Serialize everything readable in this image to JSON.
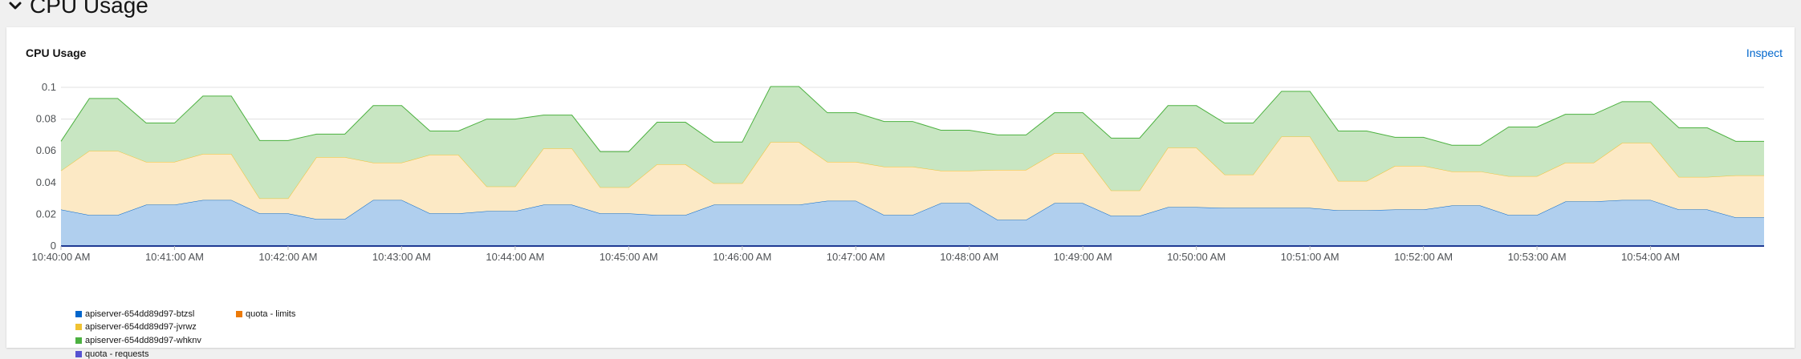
{
  "section": {
    "title": "CPU Usage",
    "chevron_icon": "chevron-down-icon"
  },
  "card": {
    "title": "CPU Usage",
    "inspect_label": "Inspect"
  },
  "colors": {
    "background": "#f0f0f0",
    "card": "#ffffff",
    "link": "#0066cc",
    "grid": "#e0e0e0"
  },
  "chart_data": {
    "type": "area",
    "stacked": true,
    "title": "CPU Usage",
    "xlabel": "",
    "ylabel": "",
    "ylim": [
      0,
      0.1
    ],
    "yticks": [
      0,
      0.02,
      0.04,
      0.06,
      0.08,
      0.1
    ],
    "ytick_labels": [
      "0",
      "0.02",
      "0.04",
      "0.06",
      "0.08",
      "0.1"
    ],
    "xlim": [
      "10:40:00 AM",
      "10:55:00 AM"
    ],
    "x_labels": [
      "10:40:00 AM",
      "10:41:00 AM",
      "10:42:00 AM",
      "10:43:00 AM",
      "10:44:00 AM",
      "10:45:00 AM",
      "10:46:00 AM",
      "10:47:00 AM",
      "10:48:00 AM",
      "10:49:00 AM",
      "10:50:00 AM",
      "10:51:00 AM",
      "10:52:00 AM",
      "10:53:00 AM",
      "10:54:00 AM"
    ],
    "grid": true,
    "legend_position": "bottom-left",
    "x": [
      "10:40:00 AM",
      "10:40:15 AM",
      "10:40:30 AM",
      "10:40:45 AM",
      "10:41:00 AM",
      "10:41:15 AM",
      "10:41:30 AM",
      "10:41:45 AM",
      "10:42:00 AM",
      "10:42:15 AM",
      "10:42:30 AM",
      "10:42:45 AM",
      "10:43:00 AM",
      "10:43:15 AM",
      "10:43:30 AM",
      "10:43:45 AM",
      "10:44:00 AM",
      "10:44:15 AM",
      "10:44:30 AM",
      "10:44:45 AM",
      "10:45:00 AM",
      "10:45:15 AM",
      "10:45:30 AM",
      "10:45:45 AM",
      "10:46:00 AM",
      "10:46:15 AM",
      "10:46:30 AM",
      "10:46:45 AM",
      "10:47:00 AM",
      "10:47:15 AM",
      "10:47:30 AM",
      "10:47:45 AM",
      "10:48:00 AM",
      "10:48:15 AM",
      "10:48:30 AM",
      "10:48:45 AM",
      "10:49:00 AM",
      "10:49:15 AM",
      "10:49:30 AM",
      "10:49:45 AM",
      "10:50:00 AM",
      "10:50:15 AM",
      "10:50:30 AM",
      "10:50:45 AM",
      "10:51:00 AM",
      "10:51:15 AM",
      "10:51:30 AM",
      "10:51:45 AM",
      "10:52:00 AM",
      "10:52:15 AM",
      "10:52:30 AM",
      "10:52:45 AM",
      "10:53:00 AM",
      "10:53:15 AM",
      "10:53:30 AM",
      "10:53:45 AM",
      "10:54:00 AM",
      "10:54:15 AM",
      "10:54:30 AM",
      "10:54:45 AM",
      "10:55:00 AM"
    ],
    "series": [
      {
        "name": "apiserver-654dd89d97-btzsl",
        "color": "#06c",
        "fill": "#b0cfee",
        "values": [
          0.023,
          0.0195,
          0.0195,
          0.026,
          0.026,
          0.029,
          0.029,
          0.0205,
          0.0205,
          0.017,
          0.017,
          0.029,
          0.029,
          0.0205,
          0.0205,
          0.022,
          0.022,
          0.026,
          0.026,
          0.0205,
          0.0205,
          0.0195,
          0.0195,
          0.026,
          0.026,
          0.026,
          0.026,
          0.0285,
          0.0285,
          0.0195,
          0.0195,
          0.027,
          0.027,
          0.0165,
          0.0165,
          0.027,
          0.027,
          0.019,
          0.019,
          0.0245,
          0.0245,
          0.024,
          0.024,
          0.024,
          0.024,
          0.0225,
          0.0225,
          0.023,
          0.023,
          0.0255,
          0.0255,
          0.0195,
          0.0195,
          0.028,
          0.028,
          0.029,
          0.029,
          0.023,
          0.023,
          0.018,
          0.018
        ]
      },
      {
        "name": "apiserver-654dd89d97-jvrwz",
        "color": "#f0c232",
        "fill": "#fce9c5",
        "values": [
          0.0245,
          0.0405,
          0.0405,
          0.027,
          0.027,
          0.029,
          0.029,
          0.0095,
          0.0095,
          0.039,
          0.039,
          0.0235,
          0.0235,
          0.037,
          0.037,
          0.0155,
          0.0155,
          0.0355,
          0.0355,
          0.0165,
          0.0165,
          0.032,
          0.032,
          0.0135,
          0.0135,
          0.0395,
          0.0395,
          0.0245,
          0.0245,
          0.0305,
          0.0305,
          0.0205,
          0.0205,
          0.0315,
          0.0315,
          0.0315,
          0.0315,
          0.016,
          0.016,
          0.0375,
          0.0375,
          0.021,
          0.021,
          0.045,
          0.045,
          0.0185,
          0.0185,
          0.0275,
          0.0275,
          0.0215,
          0.0215,
          0.0245,
          0.0245,
          0.0245,
          0.0245,
          0.036,
          0.036,
          0.0205,
          0.0205,
          0.0265,
          0.0265
        ]
      },
      {
        "name": "apiserver-654dd89d97-whknv",
        "color": "#4cb140",
        "fill": "#c8e6c2",
        "values": [
          0.0185,
          0.033,
          0.033,
          0.0245,
          0.0245,
          0.0365,
          0.0365,
          0.0365,
          0.0365,
          0.0145,
          0.0145,
          0.036,
          0.036,
          0.015,
          0.015,
          0.0425,
          0.0425,
          0.021,
          0.021,
          0.0225,
          0.0225,
          0.0265,
          0.0265,
          0.026,
          0.026,
          0.035,
          0.035,
          0.031,
          0.031,
          0.0285,
          0.0285,
          0.0255,
          0.0255,
          0.022,
          0.022,
          0.0255,
          0.0255,
          0.033,
          0.033,
          0.0265,
          0.0265,
          0.0325,
          0.0325,
          0.0285,
          0.0285,
          0.0315,
          0.0315,
          0.018,
          0.018,
          0.0165,
          0.0165,
          0.031,
          0.031,
          0.0305,
          0.0305,
          0.026,
          0.026,
          0.031,
          0.031,
          0.0215,
          0.0215
        ]
      },
      {
        "name": "quota - limits",
        "color": "#ec7a08",
        "fill": "none",
        "values": []
      },
      {
        "name": "quota - requests",
        "color": "#5752d1",
        "fill": "none",
        "values": []
      }
    ]
  }
}
